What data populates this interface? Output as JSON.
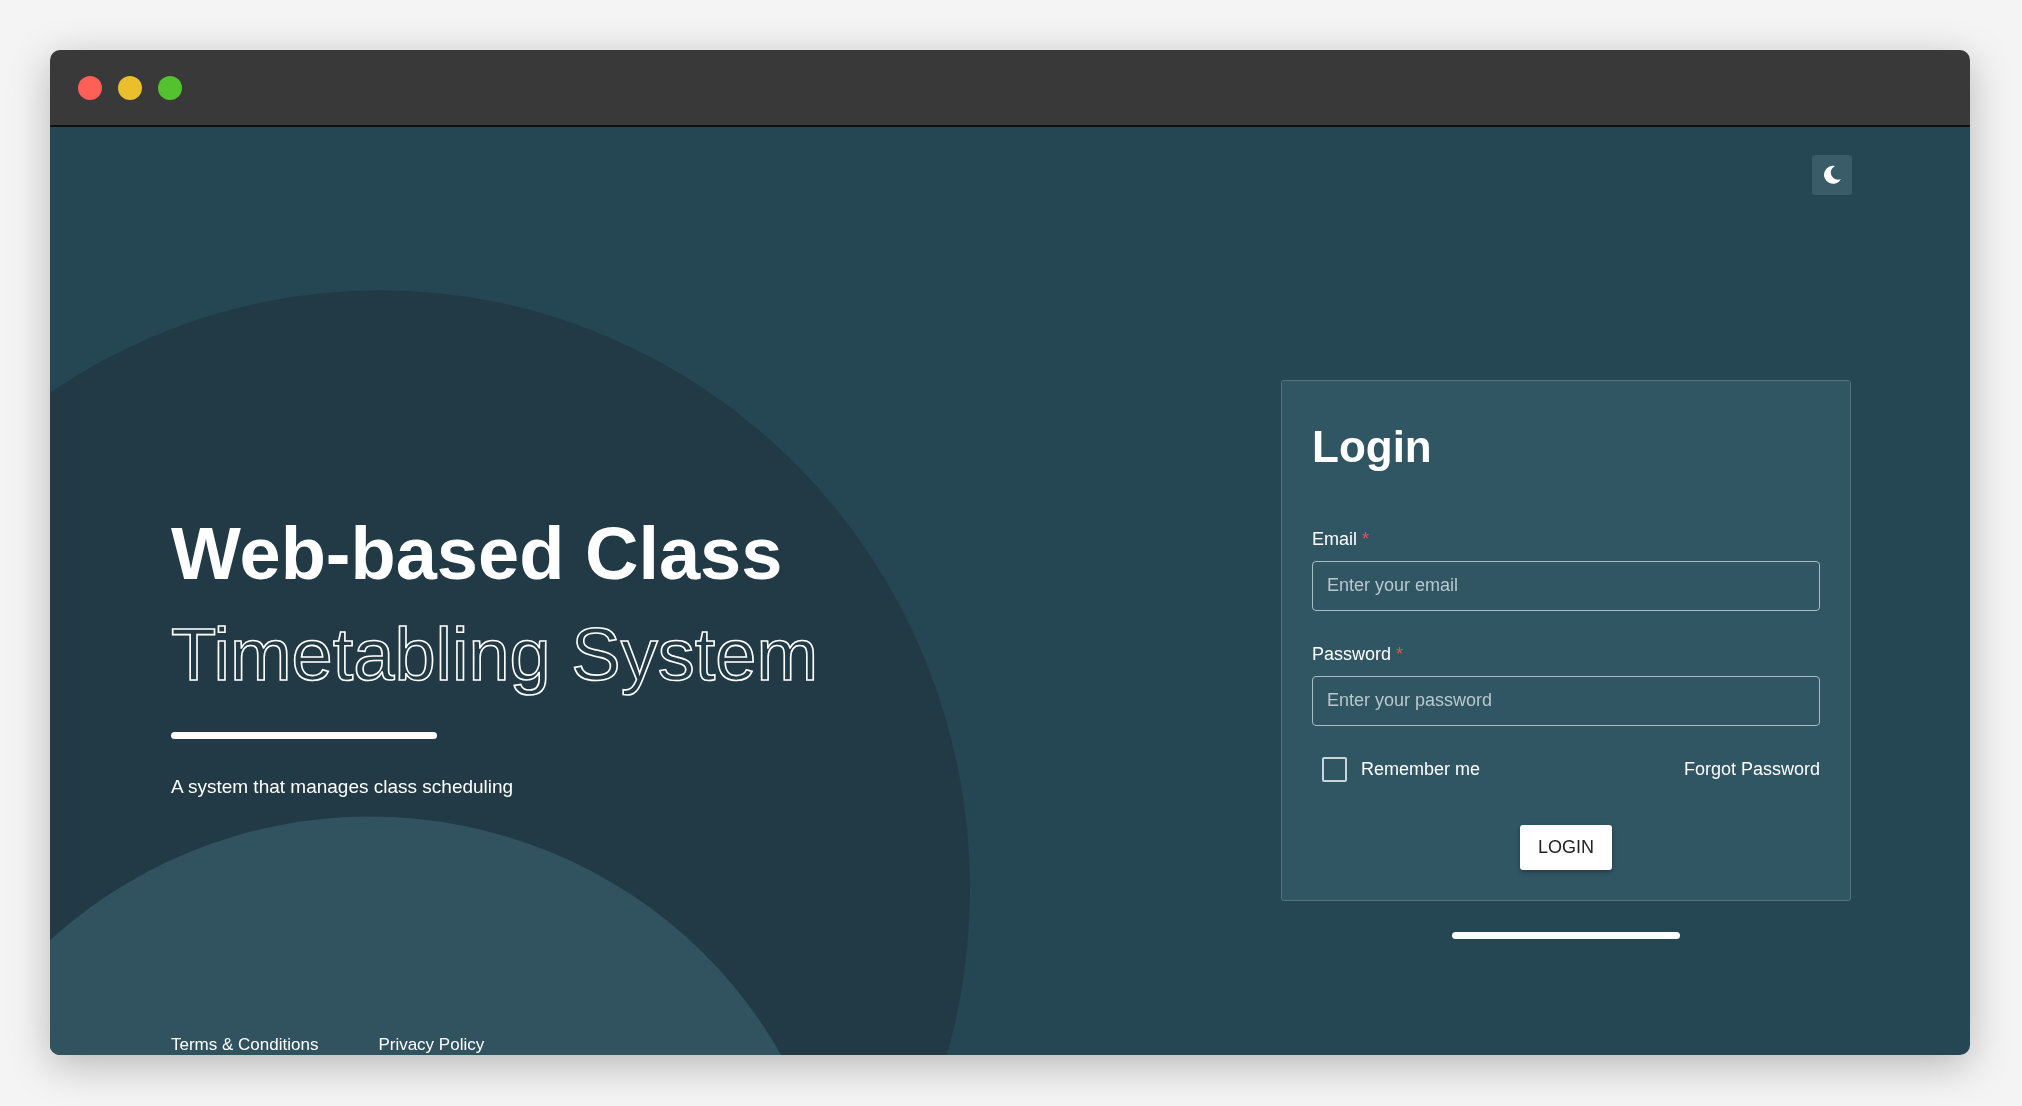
{
  "window": {
    "controls": [
      {
        "color": "#fe5f57"
      },
      {
        "color": "#e9bf2c"
      },
      {
        "color": "#53c22e"
      }
    ]
  },
  "theme_toggle": {
    "kind": "moon"
  },
  "hero": {
    "title": "Web-based Class",
    "title_outline": "Timetabling System",
    "subtitle": "A system that manages class scheduling"
  },
  "login": {
    "title": "Login",
    "fields": [
      {
        "label": "Email",
        "required_mark": "*",
        "placeholder": "Enter your email"
      },
      {
        "label": "Password",
        "required_mark": "*",
        "placeholder": "Enter your password"
      }
    ],
    "remember": {
      "label": "Remember me",
      "checked": false
    },
    "forgot": "Forgot Password",
    "button": "LOGIN"
  },
  "footer": {
    "links": [
      "Terms & Conditions",
      "Privacy Policy"
    ]
  }
}
